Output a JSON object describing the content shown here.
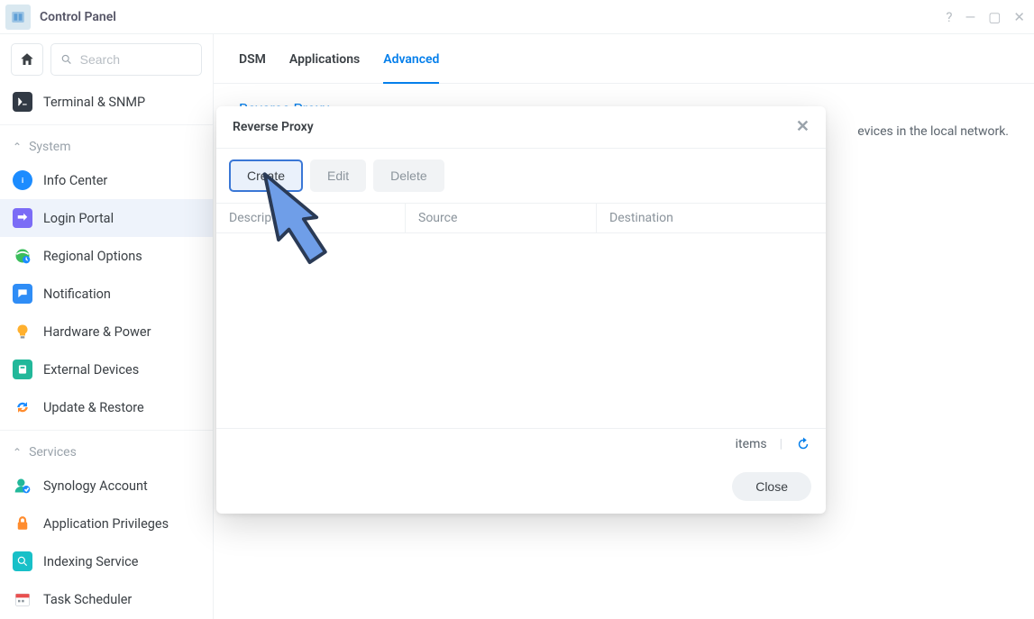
{
  "window": {
    "title": "Control Panel"
  },
  "search": {
    "placeholder": "Search"
  },
  "sidebar": {
    "pinned": [
      {
        "label": "Terminal & SNMP"
      }
    ],
    "sections": [
      {
        "name": "System",
        "items": [
          {
            "label": "Info Center"
          },
          {
            "label": "Login Portal"
          },
          {
            "label": "Regional Options"
          },
          {
            "label": "Notification"
          },
          {
            "label": "Hardware & Power"
          },
          {
            "label": "External Devices"
          },
          {
            "label": "Update & Restore"
          }
        ]
      },
      {
        "name": "Services",
        "items": [
          {
            "label": "Synology Account"
          },
          {
            "label": "Application Privileges"
          },
          {
            "label": "Indexing Service"
          },
          {
            "label": "Task Scheduler"
          }
        ]
      }
    ]
  },
  "tabs": {
    "items": [
      {
        "label": "DSM"
      },
      {
        "label": "Applications"
      },
      {
        "label": "Advanced"
      }
    ],
    "active": 2
  },
  "page": {
    "section_title": "Reverse Proxy",
    "hint_right": "evices in the local network."
  },
  "modal": {
    "title": "Reverse Proxy",
    "buttons": {
      "create": "Create",
      "edit": "Edit",
      "delete": "Delete",
      "close": "Close"
    },
    "columns": {
      "description": "Description",
      "source": "Source",
      "destination": "Destination"
    },
    "footer": {
      "items_label": "items"
    }
  }
}
